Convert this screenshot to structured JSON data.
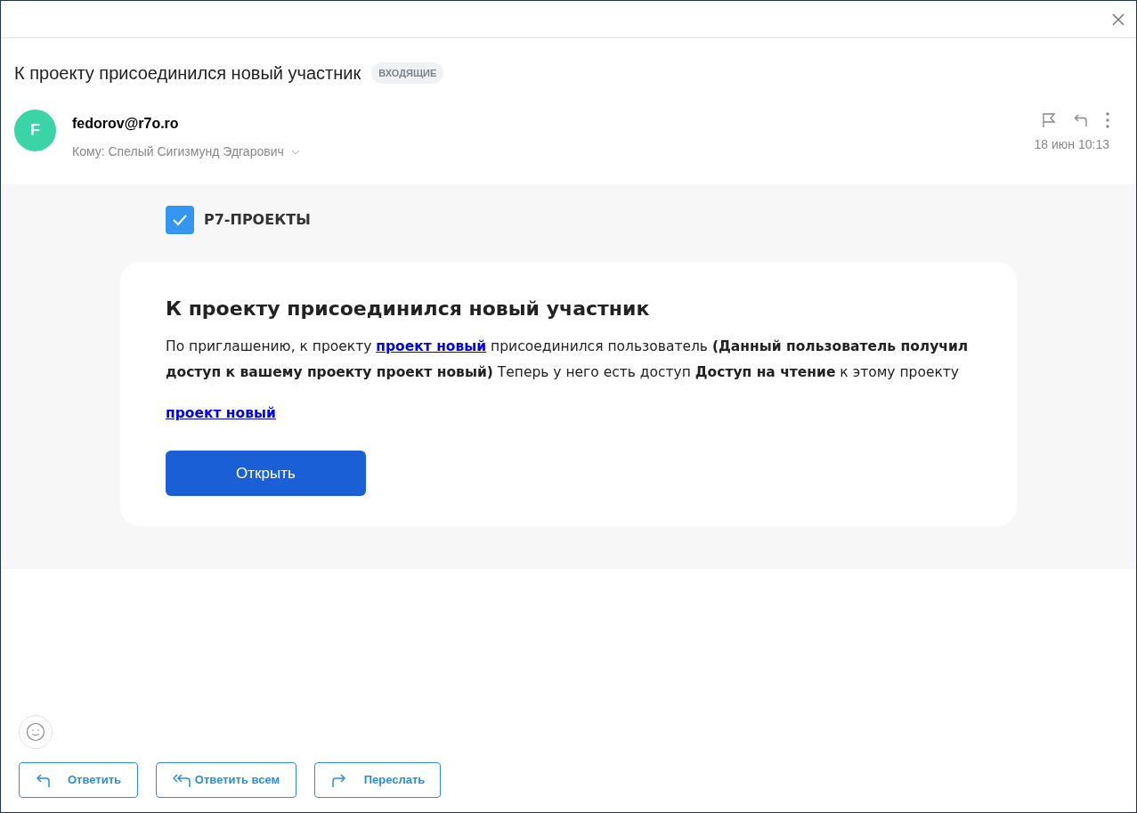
{
  "subject": "К проекту присоединился новый участник",
  "folder_badge": "ВХОДЯЩИЕ",
  "sender": {
    "avatar_letter": "F",
    "email": "fedorov@r7o.ro",
    "recipients": "Кому: Спелый Сигизмунд Эдгарович",
    "date": "18 июн 10:13"
  },
  "message": {
    "brand": "Р7-ПРОЕКТЫ",
    "heading": "К проекту присоединился новый участник",
    "paragraph": [
      {
        "kind": "text",
        "text": "По приглашению, к проекту "
      },
      {
        "kind": "link",
        "text": "проект новый"
      },
      {
        "kind": "text",
        "text": " присоединился пользователь **(Данный пользователь получил доступ к вашему проекту проект новый)** Теперь у него есть доступ **Доступ на чтение** к этому проекту"
      }
    ],
    "project_link": "проект новый",
    "open_button": "Открыть"
  },
  "actions": [
    {
      "kind": "reply",
      "label": "Ответить"
    },
    {
      "kind": "reply_all",
      "label": "Ответить всем"
    },
    {
      "kind": "forward",
      "label": "Переслать"
    }
  ]
}
